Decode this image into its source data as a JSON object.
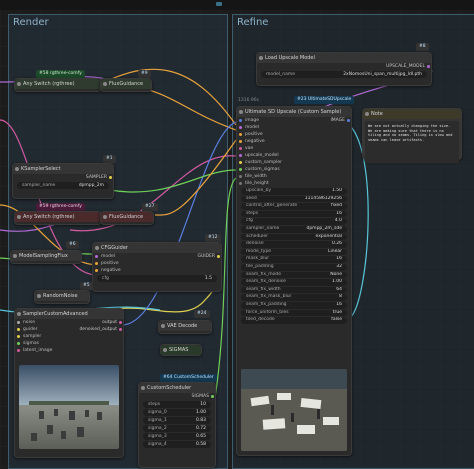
{
  "groups": {
    "render": "Render",
    "refine": "Refine"
  },
  "topbar": {
    "left_text": "",
    "right_icon": "scroll-handle-icon"
  },
  "nodes": {
    "any_switch_1": {
      "badge": "#58 rgthree-comfy",
      "badge_num": "#9",
      "title": "Any Switch (rgthree)",
      "flux_title": "FluxGuidance"
    },
    "ksampler_select": {
      "badge": "#1",
      "title": "KSamplerSelect",
      "sampler_label": "sampler_name",
      "sampler_value": "dpmpp_2m",
      "out": "SAMPLER"
    },
    "any_switch_2": {
      "badge": "#59 rgthree-comfy",
      "badge_num": "#27",
      "title": "Any Switch (rgthree)",
      "flux_title": "FluxGuidance"
    },
    "model_sampling": {
      "badge": "#6",
      "title": "ModelSamplingFlux"
    },
    "cfg_guider": {
      "badge": "#12",
      "title": "CFGGuider",
      "inputs": [
        "model",
        "positive",
        "negative"
      ],
      "out": "GUIDER",
      "cfg_label": "cfg",
      "cfg_value": "1.5"
    },
    "random_noise": {
      "badge": "#5",
      "title": "RandomNoise"
    },
    "sampler_custom": {
      "title": "SamplerCustomAdvanced",
      "inputs": [
        "noise",
        "guider",
        "sampler",
        "sigmas",
        "latent_image"
      ],
      "outputs": [
        "output",
        "denoised_output"
      ]
    },
    "vae_decode": {
      "badge": "#24",
      "title": "VAE Decode"
    },
    "sigmas": {
      "title": "SIGMAS"
    },
    "custom_scheduler": {
      "badge": "#64 CustomScheduler",
      "title": "CustomScheduler",
      "out": "SIGMAS",
      "rows": [
        {
          "label": "steps",
          "value": "10"
        },
        {
          "label": "sigma_0",
          "value": "1.00"
        },
        {
          "label": "sigma_1",
          "value": "0.83"
        },
        {
          "label": "sigma_2",
          "value": "0.72"
        },
        {
          "label": "sigma_3",
          "value": "0.65"
        },
        {
          "label": "sigma_4",
          "value": "0.58"
        }
      ]
    },
    "load_upscale": {
      "badge": "#8",
      "title": "Load Upscale Model",
      "out": "UPSCALE_MODEL",
      "model_label": "model_name",
      "model_value": "2xNomosUni_span_multijpg_ldl.pth"
    },
    "ultimate_sd": {
      "badge": "#23 UltimateSDUpscale",
      "pre_badge": "1316.96s",
      "title": "Ultimate SD Upscale (Custom Sample)",
      "out": "IMAGE",
      "inputs": [
        "image",
        "model",
        "positive",
        "negative",
        "vae",
        "upscale_model",
        "custom_sampler",
        "custom_sigmas"
      ],
      "extra_inputs": [
        "tile_width",
        "tile_height"
      ],
      "widgets": [
        {
          "label": "upscale_by",
          "value": "1.50"
        },
        {
          "label": "seed",
          "value": "1114586129256"
        },
        {
          "label": "control_after_generate",
          "value": "fixed"
        },
        {
          "label": "steps",
          "value": "16"
        },
        {
          "label": "cfg",
          "value": "4.0"
        },
        {
          "label": "sampler_name",
          "value": "dpmpp_2m_sde"
        },
        {
          "label": "scheduler",
          "value": "exponential"
        },
        {
          "label": "denoise",
          "value": "0.26"
        },
        {
          "label": "mode_type",
          "value": "Linear"
        },
        {
          "label": "mask_blur",
          "value": "16"
        },
        {
          "label": "tile_padding",
          "value": "32"
        },
        {
          "label": "seam_fix_mode",
          "value": "None"
        },
        {
          "label": "seam_fix_denoise",
          "value": "1.00"
        },
        {
          "label": "seam_fix_width",
          "value": "64"
        },
        {
          "label": "seam_fix_mask_blur",
          "value": "8"
        },
        {
          "label": "seam_fix_padding",
          "value": "16"
        },
        {
          "label": "force_uniform_tiles",
          "value": "true"
        },
        {
          "label": "tiled_decode",
          "value": "false"
        }
      ]
    },
    "note": {
      "title": "Note",
      "text": "We are not actually changing the size. We are making sure that there is no tiling and no seams. Tiling is slow and seams can leave artifacts."
    }
  },
  "colors": {
    "wire_orange": "#e8a33c",
    "wire_purple": "#b06bd6",
    "wire_green": "#6fcf5a",
    "wire_cyan": "#58c6d8",
    "wire_blue": "#5a7fe0",
    "wire_pink": "#d05aa0",
    "wire_yellow": "#e0d050",
    "badge_bg": "#14384f"
  }
}
